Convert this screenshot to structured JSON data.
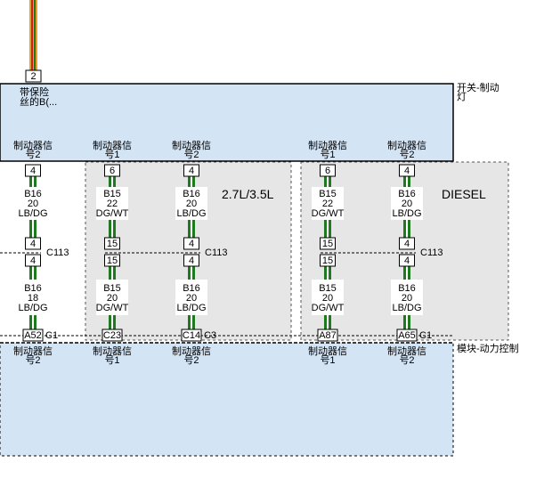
{
  "top_switch": {
    "pin": "2",
    "fuse_text_lines": [
      "带保险",
      "丝的B(..."
    ],
    "name_lines": [
      "开关-制动",
      "灯"
    ]
  },
  "pcm": {
    "name": "模块-动力控制"
  },
  "engine_labels": {
    "gas": "2.7L/3.5L",
    "diesel": "DIESEL"
  },
  "circuits": [
    {
      "id": "c1",
      "top_label": [
        "制动器信",
        "号2"
      ],
      "top_pin": "4",
      "wire_upper": [
        "B16",
        "20",
        "LB/DG"
      ],
      "splice_pin_upper": "4",
      "splice_pin_lower": "4",
      "splice_label": "C113",
      "wire_lower": [
        "B16",
        "18",
        "LB/DG"
      ],
      "bottom_pin": "A52",
      "bottom_conn": "C1",
      "bottom_label": [
        "制动器信",
        "号2"
      ]
    },
    {
      "id": "c2",
      "top_label": [
        "制动器信",
        "号1"
      ],
      "top_pin": "6",
      "wire_upper": [
        "B15",
        "22",
        "DG/WT"
      ],
      "splice_pin_upper": "15",
      "splice_pin_lower": "15",
      "splice_label": "",
      "wire_lower": [
        "B15",
        "20",
        "DG/WT"
      ],
      "bottom_pin": "C23",
      "bottom_conn": "",
      "bottom_label": [
        "制动器信",
        "号1"
      ]
    },
    {
      "id": "c3",
      "top_label": [
        "制动器信",
        "号2"
      ],
      "top_pin": "4",
      "wire_upper": [
        "B16",
        "20",
        "LB/DG"
      ],
      "splice_pin_upper": "4",
      "splice_pin_lower": "4",
      "splice_label": "C113",
      "wire_lower": [
        "B16",
        "20",
        "LB/DG"
      ],
      "bottom_pin": "C14",
      "bottom_conn": "C3",
      "bottom_label": [
        "制动器信",
        "号2"
      ]
    },
    {
      "id": "c4",
      "top_label": [
        "制动器信",
        "号1"
      ],
      "top_pin": "6",
      "wire_upper": [
        "B15",
        "22",
        "DG/WT"
      ],
      "splice_pin_upper": "15",
      "splice_pin_lower": "15",
      "splice_label": "",
      "wire_lower": [
        "B15",
        "20",
        "DG/WT"
      ],
      "bottom_pin": "A87",
      "bottom_conn": "",
      "bottom_label": [
        "制动器信",
        "号1"
      ]
    },
    {
      "id": "c5",
      "top_label": [
        "制动器信",
        "号2"
      ],
      "top_pin": "4",
      "wire_upper": [
        "B16",
        "20",
        "LB/DG"
      ],
      "splice_pin_upper": "4",
      "splice_pin_lower": "4",
      "splice_label": "C113",
      "wire_lower": [
        "B16",
        "20",
        "LB/DG"
      ],
      "bottom_pin": "A65",
      "bottom_conn": "C1",
      "bottom_label": [
        "制动器信",
        "号2"
      ]
    }
  ],
  "colors": {
    "module_fill": "#d3e4f5",
    "harness_fill": "#e6e6e6",
    "wire_green": "#1f7a1f",
    "wire_red": "#d81818",
    "wire_orange": "#e8a020"
  }
}
